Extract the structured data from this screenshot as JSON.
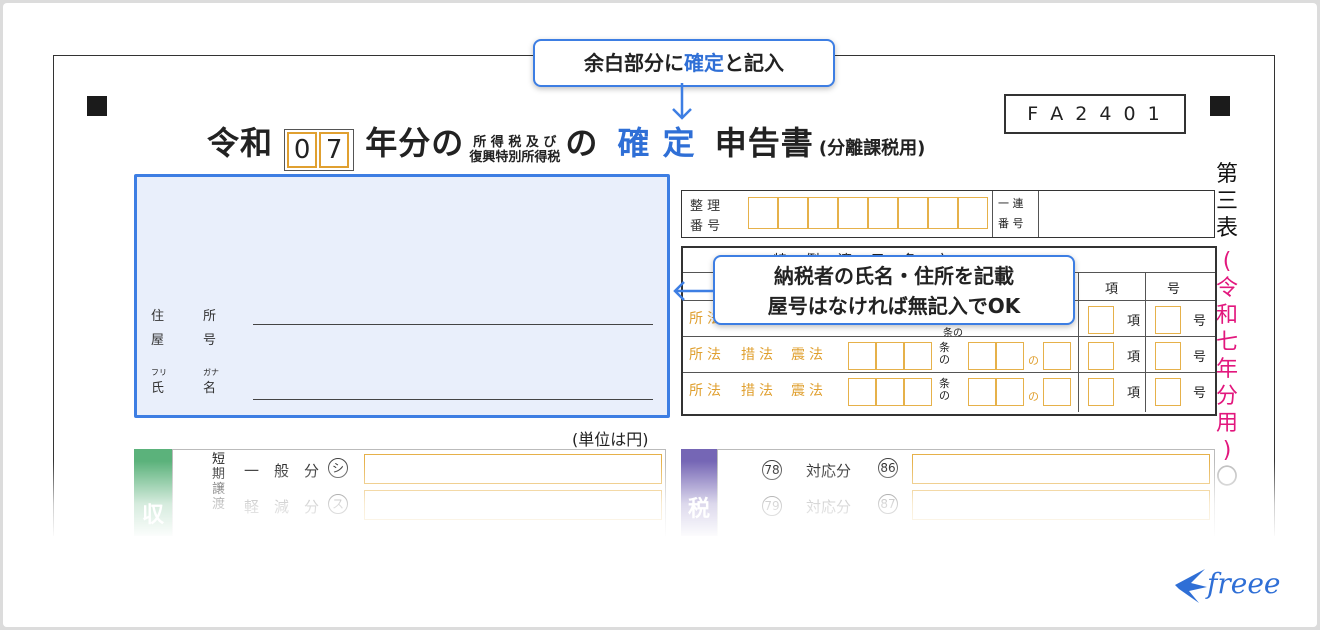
{
  "form": {
    "title_prefix": "令和",
    "year_digits": [
      "0",
      "7"
    ],
    "title_year_suffix": "年分の",
    "tax_line1": "所 得 税 及 び",
    "tax_line2": "復興特別所得税",
    "title_no": "の",
    "title_kakutei": "確 定",
    "title_shinkokusho": "申告書",
    "title_paren": "(分離課税用)",
    "form_code": "F A 2 4 0 1",
    "side_title": [
      "第",
      "三",
      "表"
    ],
    "side_year": [
      "(",
      "令",
      "和",
      "七",
      "年",
      "分",
      "用",
      ")",
      "〇"
    ],
    "unit_label": "(単位は円)",
    "seiri_label_1": "整 理",
    "seiri_label_2": "番 号",
    "renban_label_1": "一 連",
    "renban_label_2": "番 号",
    "tokurei_header": "特　 例　 適　 用　 条　 文",
    "kou": "項",
    "gou": "号",
    "jo_no": "条の",
    "no": "の",
    "shohou": [
      "所",
      "法"
    ],
    "sochihou": [
      "措",
      "法"
    ],
    "shinsaihou": [
      "震",
      "法"
    ],
    "address_label_1": "住",
    "address_label_2": "所",
    "yago_label_1": "屋",
    "yago_label_2": "号",
    "furigana_1": "フリ",
    "furigana_2": "ガナ",
    "name_label_1": "氏",
    "name_label_2": "名"
  },
  "income_section": {
    "tab_label": "収",
    "group_label": "短期譲渡",
    "rows": [
      {
        "label": "一　般　分",
        "mark": "シ"
      },
      {
        "label": "軽　減　分",
        "mark": "ス"
      }
    ]
  },
  "tax_section": {
    "tab_label": "税",
    "rows": [
      {
        "num": "78",
        "label": "対応分",
        "mark": "86"
      },
      {
        "num": "79",
        "label": "対応分",
        "mark": "87"
      }
    ]
  },
  "callouts": {
    "top": {
      "part1": "余白部分に",
      "highlight": "確定",
      "part2": "と記入"
    },
    "side": {
      "line1": "納税者の氏名・住所を記載",
      "line2": "屋号はなければ無記入でOK"
    }
  },
  "brand": {
    "logo_text": "freee"
  },
  "colors": {
    "accent": "#3d7ee3",
    "box": "#e6b14a",
    "pink": "#e2177d"
  }
}
